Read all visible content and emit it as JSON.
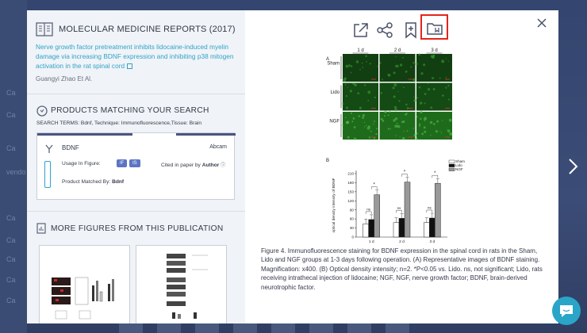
{
  "background": {
    "side_labels": [
      "Ca",
      "Ca",
      "Ca",
      "vendo",
      "Ca",
      "Ca",
      "Ca",
      "Ca",
      "Ca"
    ]
  },
  "left_panel": {
    "journal": "MOLECULAR MEDICINE REPORTS (2017)",
    "article_title": "Nerve growth factor pretreatment inhibits lidocaine-induced myelin damage via increasing BDNF expression and inhibiting p38 mitogen activation in the rat spinal cord",
    "authors": "Guangyi Zhao Et Al.",
    "products_heading": "PRODUCTS MATCHING YOUR SEARCH",
    "search_terms": "SEARCH TERMS: Bdnf, Technique: Immunofluorescence,Tissue: Brain",
    "product": {
      "name": "BDNF",
      "vendor": "Abcam",
      "usage_label": "Usage In Figure:",
      "tags": [
        "IF",
        "IS"
      ],
      "cited_label": "Cited in paper by",
      "cited_value": "Author",
      "matched_label": "Product Matched By:",
      "matched_value": "Bdnf"
    },
    "more_heading": "MORE FIGURES FROM THIS PUBLICATION"
  },
  "figure": {
    "panel_a": "A",
    "panel_b": "B",
    "columns": [
      "1 d",
      "2 d",
      "3 d"
    ],
    "rows": [
      "Sham",
      "Lido",
      "NGF"
    ]
  },
  "chart_data": {
    "type": "bar",
    "categories": [
      "1 d",
      "2 d",
      "3 d"
    ],
    "series": [
      {
        "name": "Sham",
        "values": [
          44,
          48,
          48
        ]
      },
      {
        "name": "Lido",
        "values": [
          58,
          62,
          63
        ]
      },
      {
        "name": "NGF",
        "values": [
          140,
          182,
          178
        ]
      }
    ],
    "ylabel": "optical density intensity of BDNF",
    "xlabel": "Post-operative day",
    "ylim": [
      0,
      210
    ],
    "yticks": [
      0,
      30,
      60,
      90,
      120,
      150,
      180,
      210
    ],
    "annotations": [
      "ns",
      "*",
      "ns",
      "*",
      "ns",
      "*"
    ],
    "legend": "top-right"
  },
  "caption": "Figure 4. Immunofluorescence staining for BDNF expression in the spinal cord in rats in the Sham, Lido and NGF groups at 1-3 days following operation. (A) Representative images of BDNF staining. Magnification: x400. (B) Optical density intensity; n=2. *P<0.05 vs. Lido. ns, not significant; Lido, rats receiving intrathecal injection of lidocaine; NGF, NGF, nerve growth factor; BDNF, brain-derived neurotrophic factor.",
  "colors": {
    "accent": "#2fa3c9",
    "highlight": "#e3251c",
    "tag": "#5b74c4"
  }
}
